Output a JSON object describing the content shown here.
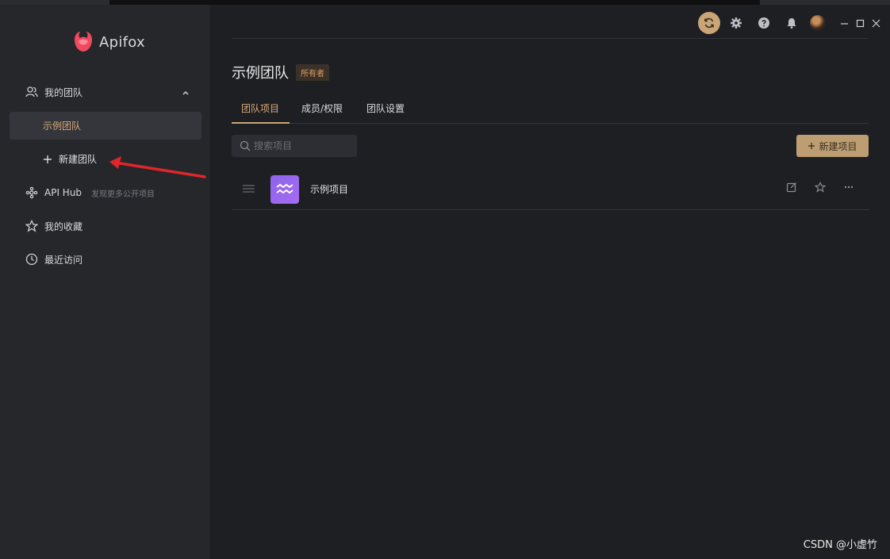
{
  "app": {
    "name": "Apifox"
  },
  "sidebar": {
    "my_team_label": "我的团队",
    "selected_team": "示例团队",
    "new_team_label": "新建团队",
    "api_hub_label": "API Hub",
    "api_hub_sub": "发现更多公开项目",
    "favorites_label": "我的收藏",
    "recent_label": "最近访问"
  },
  "header": {
    "team_title": "示例团队",
    "owner_badge": "所有者"
  },
  "tabs": [
    {
      "label": "团队项目",
      "active": true
    },
    {
      "label": "成员/权限",
      "active": false
    },
    {
      "label": "团队设置",
      "active": false
    }
  ],
  "search": {
    "placeholder": "搜索项目"
  },
  "new_project_button": "新建项目",
  "projects": [
    {
      "name": "示例项目"
    }
  ],
  "watermark": "CSDN @小虚竹",
  "colors": {
    "accent": "#c9a578",
    "sidebar_bg": "#26272b",
    "main_bg": "#1e1f22",
    "project_icon": "#9b69ef",
    "annotation_arrow": "#e0262b"
  }
}
